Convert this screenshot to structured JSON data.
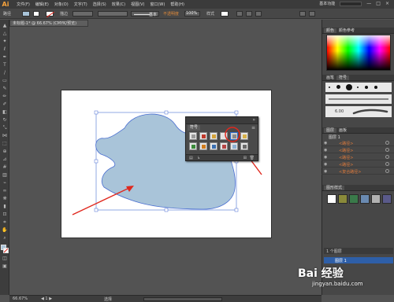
{
  "app": {
    "logo": "Ai",
    "workspace": "基本功能",
    "search_placeholder": ""
  },
  "menu": [
    "文件(F)",
    "编辑(E)",
    "对象(O)",
    "文字(T)",
    "选择(S)",
    "效果(C)",
    "视图(V)",
    "窗口(W)",
    "帮助(H)"
  ],
  "control_bar": {
    "selection_label": "路径",
    "stroke_label": "描边",
    "stroke_style": "基本",
    "opacity_label": "不透明度",
    "opacity_value": "100%",
    "style_label": "样式"
  },
  "document_tab": "未标题-1* @ 66.67% (CMYK/预览)",
  "symbols_panel": {
    "title": "符号"
  },
  "right_dock": {
    "color_tabs": [
      "颜色",
      "颜色参考"
    ],
    "brush_tabs": [
      "画笔",
      "符号"
    ],
    "brush_size": "6.00",
    "layers_tabs": [
      "图层",
      "画板"
    ],
    "layer_group": "图层 1",
    "layers": [
      "<路径>",
      "<路径>",
      "<路径>",
      "<路径>",
      "<复合路径>"
    ],
    "graphic_styles_title": "图形样式",
    "layers_footer": "1 个图层"
  },
  "status": {
    "zoom": "66.67%",
    "tool": "选择"
  },
  "watermark": {
    "brand": "Bai 经验",
    "url": "jingyan.baidu.com"
  },
  "colors": {
    "shape_fill": "#a9c4d9",
    "shape_stroke": "#4a6fd1",
    "arrow": "#e0281e"
  }
}
